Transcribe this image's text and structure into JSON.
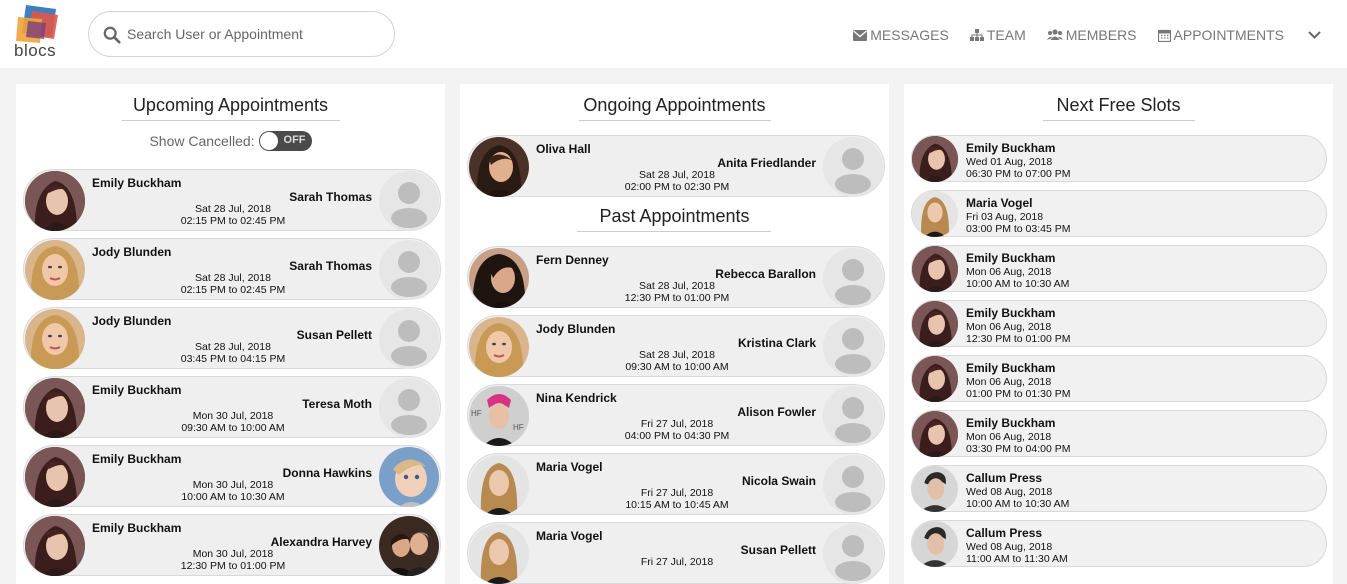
{
  "header": {
    "logo_text": "blocs",
    "search_placeholder": "Search User or Appointment",
    "nav": [
      {
        "label": "MESSAGES",
        "icon": "envelope-icon"
      },
      {
        "label": "TEAM",
        "icon": "sitemap-icon"
      },
      {
        "label": "MEMBERS",
        "icon": "users-icon"
      },
      {
        "label": "APPOINTMENTS",
        "icon": "calendar-icon"
      }
    ]
  },
  "colors": {
    "background": "#f3f3f3",
    "card": "#efefef",
    "toggle": "#4a4a4a"
  },
  "upcoming": {
    "title": "Upcoming Appointments",
    "toggle_label": "Show Cancelled:",
    "toggle_state": "OFF",
    "items": [
      {
        "member": "Emily Buckham",
        "staff": "Sarah Thomas",
        "date": "Sat 28 Jul, 2018",
        "time": "02:15 PM to 02:45 PM"
      },
      {
        "member": "Jody Blunden",
        "staff": "Sarah Thomas",
        "date": "Sat 28 Jul, 2018",
        "time": "02:15 PM to 02:45 PM"
      },
      {
        "member": "Jody Blunden",
        "staff": "Susan Pellett",
        "date": "Sat 28 Jul, 2018",
        "time": "03:45 PM to 04:15 PM"
      },
      {
        "member": "Emily Buckham",
        "staff": "Teresa Moth",
        "date": "Mon 30 Jul, 2018",
        "time": "09:30 AM to 10:00 AM"
      },
      {
        "member": "Emily Buckham",
        "staff": "Donna Hawkins",
        "date": "Mon 30 Jul, 2018",
        "time": "10:00 AM to 10:30 AM"
      },
      {
        "member": "Emily Buckham",
        "staff": "Alexandra Harvey",
        "date": "Mon 30 Jul, 2018",
        "time": "12:30 PM to 01:00 PM"
      }
    ]
  },
  "ongoing": {
    "title": "Ongoing Appointments",
    "items": [
      {
        "member": "Oliva Hall",
        "staff": "Anita Friedlander",
        "date": "Sat 28 Jul, 2018",
        "time": "02:00 PM to 02:30 PM"
      }
    ]
  },
  "past": {
    "title": "Past Appointments",
    "items": [
      {
        "member": "Fern Denney",
        "staff": "Rebecca Barallon",
        "date": "Sat 28 Jul, 2018",
        "time": "12:30 PM to 01:00 PM"
      },
      {
        "member": "Jody Blunden",
        "staff": "Kristina Clark",
        "date": "Sat 28 Jul, 2018",
        "time": "09:30 AM to 10:00 AM"
      },
      {
        "member": "Nina Kendrick",
        "staff": "Alison Fowler",
        "date": "Fri 27 Jul, 2018",
        "time": "04:00 PM to 04:30 PM"
      },
      {
        "member": "Maria Vogel",
        "staff": "Nicola Swain",
        "date": "Fri 27 Jul, 2018",
        "time": "10:15 AM to 10:45 AM"
      },
      {
        "member": "Maria Vogel",
        "staff": "Susan Pellett",
        "date": "Fri 27 Jul, 2018",
        "time": ""
      }
    ]
  },
  "free_slots": {
    "title": "Next Free Slots",
    "items": [
      {
        "name": "Emily Buckham",
        "date": "Wed 01 Aug, 2018",
        "time": "06:30 PM to 07:00 PM"
      },
      {
        "name": "Maria Vogel",
        "date": "Fri 03 Aug, 2018",
        "time": "03:00 PM to 03:45 PM"
      },
      {
        "name": "Emily Buckham",
        "date": "Mon 06 Aug, 2018",
        "time": "10:00 AM to 10:30 AM"
      },
      {
        "name": "Emily Buckham",
        "date": "Mon 06 Aug, 2018",
        "time": "12:30 PM to 01:00 PM"
      },
      {
        "name": "Emily Buckham",
        "date": "Mon 06 Aug, 2018",
        "time": "01:00 PM to 01:30 PM"
      },
      {
        "name": "Emily Buckham",
        "date": "Mon 06 Aug, 2018",
        "time": "03:30 PM to 04:00 PM"
      },
      {
        "name": "Callum Press",
        "date": "Wed 08 Aug, 2018",
        "time": "10:00 AM to 10:30 AM"
      },
      {
        "name": "Callum Press",
        "date": "Wed 08 Aug, 2018",
        "time": "11:00 AM to 11:30 AM"
      }
    ]
  }
}
